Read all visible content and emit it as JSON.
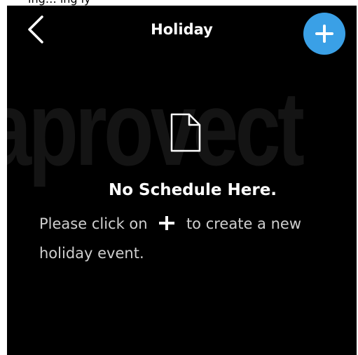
{
  "top_strip": {
    "text": "ing…        ing     ly"
  },
  "header": {
    "title": "Holiday",
    "back_icon": "chevron-left-icon",
    "add_icon": "plus-icon",
    "accent_color": "#3aa0e6"
  },
  "watermark": {
    "text": "aprovect"
  },
  "empty_state": {
    "icon": "document-icon",
    "title": "No Schedule Here.",
    "desc_before": "Please click on",
    "desc_after": "to create a new holiday event."
  },
  "colors": {
    "background": "#000000",
    "text": "#ffffff",
    "secondary_text": "#cfcfcf"
  }
}
